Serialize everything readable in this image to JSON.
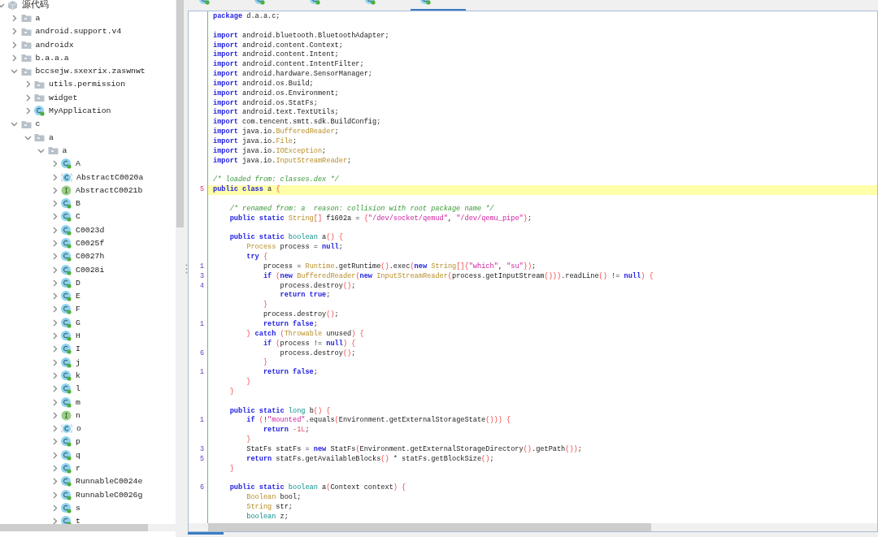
{
  "tree": {
    "label": "源代码",
    "kind": "root",
    "expanded": true,
    "children": [
      {
        "label": "a",
        "kind": "package",
        "expanded": false
      },
      {
        "label": "android.support.v4",
        "kind": "package",
        "expanded": false
      },
      {
        "label": "androidx",
        "kind": "package",
        "expanded": false
      },
      {
        "label": "b.a.a.a",
        "kind": "package",
        "expanded": false
      },
      {
        "label": "bccsejw.sxexrix.zaswnwt",
        "kind": "package",
        "expanded": true,
        "children": [
          {
            "label": "utils.permission",
            "kind": "package",
            "expanded": false
          },
          {
            "label": "widget",
            "kind": "package",
            "expanded": false
          },
          {
            "label": "MyApplication",
            "kind": "class",
            "expanded": false
          }
        ]
      },
      {
        "label": "c",
        "kind": "package",
        "expanded": true,
        "children": [
          {
            "label": "a",
            "kind": "package",
            "expanded": true,
            "children": [
              {
                "label": "a",
                "kind": "package",
                "expanded": true,
                "children": [
                  {
                    "label": "A",
                    "kind": "class",
                    "expanded": false
                  },
                  {
                    "label": "AbstractC0020a",
                    "kind": "abstract",
                    "expanded": false
                  },
                  {
                    "label": "AbstractC0021b",
                    "kind": "interface",
                    "expanded": false
                  },
                  {
                    "label": "B",
                    "kind": "class",
                    "expanded": false
                  },
                  {
                    "label": "C",
                    "kind": "class",
                    "expanded": false
                  },
                  {
                    "label": "C0023d",
                    "kind": "class",
                    "expanded": false
                  },
                  {
                    "label": "C0025f",
                    "kind": "class",
                    "expanded": false
                  },
                  {
                    "label": "C0027h",
                    "kind": "class",
                    "expanded": false
                  },
                  {
                    "label": "C0028i",
                    "kind": "class",
                    "expanded": false
                  },
                  {
                    "label": "D",
                    "kind": "class",
                    "expanded": false
                  },
                  {
                    "label": "E",
                    "kind": "class",
                    "expanded": false
                  },
                  {
                    "label": "F",
                    "kind": "class",
                    "expanded": false
                  },
                  {
                    "label": "G",
                    "kind": "class",
                    "expanded": false
                  },
                  {
                    "label": "H",
                    "kind": "class",
                    "expanded": false
                  },
                  {
                    "label": "I",
                    "kind": "class",
                    "expanded": false
                  },
                  {
                    "label": "j",
                    "kind": "class",
                    "expanded": false
                  },
                  {
                    "label": "k",
                    "kind": "class",
                    "expanded": false
                  },
                  {
                    "label": "l",
                    "kind": "class",
                    "expanded": false
                  },
                  {
                    "label": "m",
                    "kind": "class",
                    "expanded": false
                  },
                  {
                    "label": "n",
                    "kind": "interface",
                    "expanded": false
                  },
                  {
                    "label": "o",
                    "kind": "abstract",
                    "expanded": false
                  },
                  {
                    "label": "p",
                    "kind": "class",
                    "expanded": false
                  },
                  {
                    "label": "q",
                    "kind": "class",
                    "expanded": false
                  },
                  {
                    "label": "r",
                    "kind": "class",
                    "expanded": false
                  },
                  {
                    "label": "RunnableC0024e",
                    "kind": "class",
                    "expanded": false
                  },
                  {
                    "label": "RunnableC0026g",
                    "kind": "class",
                    "expanded": false
                  },
                  {
                    "label": "s",
                    "kind": "class",
                    "expanded": false
                  },
                  {
                    "label": "t",
                    "kind": "class",
                    "expanded": false
                  }
                ]
              }
            ]
          }
        ]
      }
    ]
  },
  "editor_tabs": [
    {
      "selected": false
    },
    {
      "selected": false
    },
    {
      "selected": false
    },
    {
      "selected": false
    },
    {
      "selected": true
    }
  ],
  "code_lines": [
    {
      "current": false,
      "tokens": [
        {
          "kind": "kw",
          "text": "package"
        },
        {
          "kind": "txt",
          "text": " d.a.a.c;"
        }
      ]
    },
    {
      "current": false
    },
    {
      "current": false,
      "tokens": [
        {
          "kind": "kw",
          "text": "import"
        },
        {
          "kind": "txt",
          "text": " android.bluetooth.BluetoothAdapter;"
        }
      ]
    },
    {
      "current": false,
      "tokens": [
        {
          "kind": "kw",
          "text": "import"
        },
        {
          "kind": "txt",
          "text": " android.content.Context;"
        }
      ]
    },
    {
      "current": false,
      "tokens": [
        {
          "kind": "kw",
          "text": "import"
        },
        {
          "kind": "txt",
          "text": " android.content.Intent;"
        }
      ]
    },
    {
      "current": false,
      "tokens": [
        {
          "kind": "kw",
          "text": "import"
        },
        {
          "kind": "txt",
          "text": " android.content.IntentFilter;"
        }
      ]
    },
    {
      "current": false,
      "tokens": [
        {
          "kind": "kw",
          "text": "import"
        },
        {
          "kind": "txt",
          "text": " android.hardware.SensorManager;"
        }
      ]
    },
    {
      "current": false,
      "tokens": [
        {
          "kind": "kw",
          "text": "import"
        },
        {
          "kind": "txt",
          "text": " android.os.Build;"
        }
      ]
    },
    {
      "current": false,
      "tokens": [
        {
          "kind": "kw",
          "text": "import"
        },
        {
          "kind": "txt",
          "text": " android.os.Environment;"
        }
      ]
    },
    {
      "current": false,
      "tokens": [
        {
          "kind": "kw",
          "text": "import"
        },
        {
          "kind": "txt",
          "text": " android.os.StatFs;"
        }
      ]
    },
    {
      "current": false,
      "tokens": [
        {
          "kind": "kw",
          "text": "import"
        },
        {
          "kind": "txt",
          "text": " android.text.TextUtils;"
        }
      ]
    },
    {
      "current": false,
      "tokens": [
        {
          "kind": "kw",
          "text": "import"
        },
        {
          "kind": "txt",
          "text": " com.tencent.smtt.sdk.BuildConfig;"
        }
      ]
    },
    {
      "current": false,
      "tokens": [
        {
          "kind": "kw",
          "text": "import"
        },
        {
          "kind": "txt",
          "text": " java.io."
        },
        {
          "kind": "cls",
          "text": "BufferedReader"
        },
        {
          "kind": "txt",
          "text": ";"
        }
      ]
    },
    {
      "current": false,
      "tokens": [
        {
          "kind": "kw",
          "text": "import"
        },
        {
          "kind": "txt",
          "text": " java.io."
        },
        {
          "kind": "cls",
          "text": "File"
        },
        {
          "kind": "txt",
          "text": ";"
        }
      ]
    },
    {
      "current": false,
      "tokens": [
        {
          "kind": "kw",
          "text": "import"
        },
        {
          "kind": "txt",
          "text": " java.io."
        },
        {
          "kind": "cls",
          "text": "IOException"
        },
        {
          "kind": "txt",
          "text": ";"
        }
      ]
    },
    {
      "current": false,
      "tokens": [
        {
          "kind": "kw",
          "text": "import"
        },
        {
          "kind": "txt",
          "text": " java.io."
        },
        {
          "kind": "cls",
          "text": "InputStreamReader"
        },
        {
          "kind": "txt",
          "text": ";"
        }
      ]
    },
    {
      "current": false
    },
    {
      "current": false,
      "tokens": [
        {
          "kind": "com",
          "text": "/* loaded from: classes.dex */"
        }
      ]
    },
    {
      "number": "5",
      "current": true,
      "tokens": [
        {
          "kind": "kw",
          "text": "public class"
        },
        {
          "kind": "txt",
          "text": " a "
        },
        {
          "kind": "sep",
          "text": "{"
        }
      ]
    },
    {
      "current": false
    },
    {
      "current": false,
      "tokens": [
        {
          "kind": "com",
          "text": "    /* renamed from: a  reason: collision with root package name */"
        }
      ]
    },
    {
      "current": false,
      "tokens": [
        {
          "kind": "kw",
          "text": "    public static "
        },
        {
          "kind": "cls",
          "text": "String"
        },
        {
          "kind": "sep",
          "text": "[]"
        },
        {
          "kind": "txt",
          "text": " f1602a = "
        },
        {
          "kind": "sep",
          "text": "{"
        },
        {
          "kind": "str",
          "text": "\"/dev/socket/qemud\""
        },
        {
          "kind": "txt",
          "text": ", "
        },
        {
          "kind": "str",
          "text": "\"/dev/qemu_pipe\""
        },
        {
          "kind": "sep",
          "text": "}"
        },
        {
          "kind": "txt",
          "text": ";"
        }
      ]
    },
    {
      "current": false
    },
    {
      "current": false,
      "tokens": [
        {
          "kind": "kw",
          "text": "    public static "
        },
        {
          "kind": "type",
          "text": "boolean"
        },
        {
          "kind": "txt",
          "text": " a"
        },
        {
          "kind": "sep",
          "text": "() {"
        }
      ]
    },
    {
      "current": false,
      "tokens": [
        {
          "kind": "cls",
          "text": "        Process"
        },
        {
          "kind": "txt",
          "text": " process = "
        },
        {
          "kind": "kw",
          "text": "null"
        },
        {
          "kind": "txt",
          "text": ";"
        }
      ]
    },
    {
      "current": false,
      "tokens": [
        {
          "kind": "kw",
          "text": "        try "
        },
        {
          "kind": "sep",
          "text": "{"
        }
      ]
    },
    {
      "number": "1",
      "current": false,
      "tokens": [
        {
          "kind": "txt",
          "text": "            process = "
        },
        {
          "kind": "cls",
          "text": "Runtime"
        },
        {
          "kind": "txt",
          "text": ".getRuntime"
        },
        {
          "kind": "sep",
          "text": "()"
        },
        {
          "kind": "txt",
          "text": ".exec"
        },
        {
          "kind": "sep",
          "text": "("
        },
        {
          "kind": "kw",
          "text": "new "
        },
        {
          "kind": "cls",
          "text": "String"
        },
        {
          "kind": "sep",
          "text": "[]{"
        },
        {
          "kind": "str",
          "text": "\"which\""
        },
        {
          "kind": "txt",
          "text": ", "
        },
        {
          "kind": "str",
          "text": "\"su\""
        },
        {
          "kind": "sep",
          "text": "})"
        },
        {
          "kind": "txt",
          "text": ";"
        }
      ]
    },
    {
      "number": "3",
      "current": false,
      "tokens": [
        {
          "kind": "kw",
          "text": "            if "
        },
        {
          "kind": "sep",
          "text": "("
        },
        {
          "kind": "kw",
          "text": "new "
        },
        {
          "kind": "cls",
          "text": "BufferedReader"
        },
        {
          "kind": "sep",
          "text": "("
        },
        {
          "kind": "kw",
          "text": "new "
        },
        {
          "kind": "cls",
          "text": "InputStreamReader"
        },
        {
          "kind": "sep",
          "text": "("
        },
        {
          "kind": "txt",
          "text": "process.getInputStream"
        },
        {
          "kind": "sep",
          "text": "()))"
        },
        {
          "kind": "txt",
          "text": ".readLine"
        },
        {
          "kind": "sep",
          "text": "()"
        },
        {
          "kind": "txt",
          "text": " != "
        },
        {
          "kind": "kw",
          "text": "null"
        },
        {
          "kind": "sep",
          "text": ") {"
        }
      ]
    },
    {
      "number": "4",
      "current": false,
      "tokens": [
        {
          "kind": "txt",
          "text": "                process.destroy"
        },
        {
          "kind": "sep",
          "text": "()"
        },
        {
          "kind": "txt",
          "text": ";"
        }
      ]
    },
    {
      "current": false,
      "tokens": [
        {
          "kind": "kw",
          "text": "                return true"
        },
        {
          "kind": "txt",
          "text": ";"
        }
      ]
    },
    {
      "current": false,
      "tokens": [
        {
          "kind": "sep",
          "text": "            }"
        }
      ]
    },
    {
      "current": false,
      "tokens": [
        {
          "kind": "txt",
          "text": "            process.destroy"
        },
        {
          "kind": "sep",
          "text": "()"
        },
        {
          "kind": "txt",
          "text": ";"
        }
      ]
    },
    {
      "number": "1",
      "current": false,
      "tokens": [
        {
          "kind": "kw",
          "text": "            return false"
        },
        {
          "kind": "txt",
          "text": ";"
        }
      ]
    },
    {
      "current": false,
      "tokens": [
        {
          "kind": "sep",
          "text": "        } "
        },
        {
          "kind": "kw",
          "text": "catch "
        },
        {
          "kind": "sep",
          "text": "("
        },
        {
          "kind": "cls",
          "text": "Throwable"
        },
        {
          "kind": "txt",
          "text": " unused"
        },
        {
          "kind": "sep",
          "text": ") {"
        }
      ]
    },
    {
      "current": false,
      "tokens": [
        {
          "kind": "kw",
          "text": "            if "
        },
        {
          "kind": "sep",
          "text": "("
        },
        {
          "kind": "txt",
          "text": "process != "
        },
        {
          "kind": "kw",
          "text": "null"
        },
        {
          "kind": "sep",
          "text": ") {"
        }
      ]
    },
    {
      "number": "6",
      "current": false,
      "tokens": [
        {
          "kind": "txt",
          "text": "                process.destroy"
        },
        {
          "kind": "sep",
          "text": "()"
        },
        {
          "kind": "txt",
          "text": ";"
        }
      ]
    },
    {
      "current": false,
      "tokens": [
        {
          "kind": "sep",
          "text": "            }"
        }
      ]
    },
    {
      "number": "1",
      "current": false,
      "tokens": [
        {
          "kind": "kw",
          "text": "            return false"
        },
        {
          "kind": "txt",
          "text": ";"
        }
      ]
    },
    {
      "current": false,
      "tokens": [
        {
          "kind": "sep",
          "text": "        }"
        }
      ]
    },
    {
      "current": false,
      "tokens": [
        {
          "kind": "sep",
          "text": "    }"
        }
      ]
    },
    {
      "current": false
    },
    {
      "current": false,
      "tokens": [
        {
          "kind": "kw",
          "text": "    public static "
        },
        {
          "kind": "type",
          "text": "long"
        },
        {
          "kind": "txt",
          "text": " b"
        },
        {
          "kind": "sep",
          "text": "() {"
        }
      ]
    },
    {
      "number": "1",
      "current": false,
      "tokens": [
        {
          "kind": "kw",
          "text": "        if "
        },
        {
          "kind": "sep",
          "text": "("
        },
        {
          "kind": "txt",
          "text": "!"
        },
        {
          "kind": "str",
          "text": "\"mounted\""
        },
        {
          "kind": "txt",
          "text": ".equals"
        },
        {
          "kind": "sep",
          "text": "("
        },
        {
          "kind": "txt",
          "text": "Environment.getExternalStorageState"
        },
        {
          "kind": "sep",
          "text": "())) {"
        }
      ]
    },
    {
      "current": false,
      "tokens": [
        {
          "kind": "kw",
          "text": "            return "
        },
        {
          "kind": "num",
          "text": "-1L"
        },
        {
          "kind": "txt",
          "text": ";"
        }
      ]
    },
    {
      "current": false,
      "tokens": [
        {
          "kind": "sep",
          "text": "        }"
        }
      ]
    },
    {
      "number": "3",
      "current": false,
      "tokens": [
        {
          "kind": "txt",
          "text": "        StatFs statFs = "
        },
        {
          "kind": "kw",
          "text": "new"
        },
        {
          "kind": "txt",
          "text": " StatFs"
        },
        {
          "kind": "sep",
          "text": "("
        },
        {
          "kind": "txt",
          "text": "Environment.getExternalStorageDirectory"
        },
        {
          "kind": "sep",
          "text": "()"
        },
        {
          "kind": "txt",
          "text": ".getPath"
        },
        {
          "kind": "sep",
          "text": "())"
        },
        {
          "kind": "txt",
          "text": ";"
        }
      ]
    },
    {
      "number": "5",
      "current": false,
      "tokens": [
        {
          "kind": "kw",
          "text": "        return"
        },
        {
          "kind": "txt",
          "text": " statFs.getAvailableBlocks"
        },
        {
          "kind": "sep",
          "text": "()"
        },
        {
          "kind": "txt",
          "text": " * statFs.getBlockSize"
        },
        {
          "kind": "sep",
          "text": "()"
        },
        {
          "kind": "txt",
          "text": ";"
        }
      ]
    },
    {
      "current": false,
      "tokens": [
        {
          "kind": "sep",
          "text": "    }"
        }
      ]
    },
    {
      "current": false
    },
    {
      "number": "6",
      "current": false,
      "tokens": [
        {
          "kind": "kw",
          "text": "    public static "
        },
        {
          "kind": "type",
          "text": "boolean"
        },
        {
          "kind": "txt",
          "text": " a"
        },
        {
          "kind": "sep",
          "text": "("
        },
        {
          "kind": "txt",
          "text": "Context context"
        },
        {
          "kind": "sep",
          "text": ") {"
        }
      ]
    },
    {
      "current": false,
      "tokens": [
        {
          "kind": "cls",
          "text": "        Boolean"
        },
        {
          "kind": "txt",
          "text": " bool;"
        }
      ]
    },
    {
      "current": false,
      "tokens": [
        {
          "kind": "cls",
          "text": "        String"
        },
        {
          "kind": "txt",
          "text": " str;"
        }
      ]
    },
    {
      "current": false,
      "tokens": [
        {
          "kind": "type",
          "text": "        boolean"
        },
        {
          "kind": "txt",
          "text": " z;"
        }
      ]
    }
  ]
}
